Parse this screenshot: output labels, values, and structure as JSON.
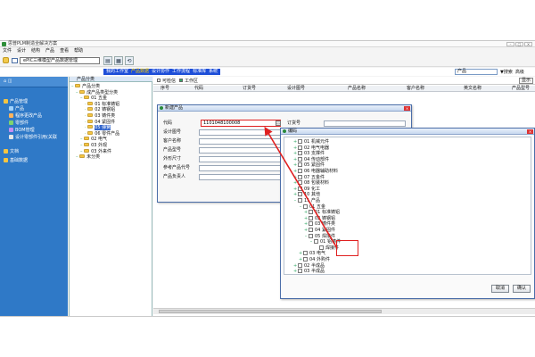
{
  "window": {
    "title": "思普PLM制造全解决方案",
    "controls": [
      "–",
      "□",
      "×"
    ]
  },
  "menu": [
    "文件",
    "设计",
    "结构",
    "产品",
    "查看",
    "帮助"
  ],
  "toolbar": {
    "combo_value": "ePIC三维模型产品数据管理",
    "buttons": [
      "▤",
      "▦",
      "⟲"
    ]
  },
  "worklinks": {
    "items": [
      "我的工作室",
      "产品数据",
      "设计协作",
      "工作流程",
      "标准库",
      "系统"
    ],
    "current_index": 1
  },
  "search": {
    "select_value": "产品",
    "button": "▼搜索",
    "advanced": "高级"
  },
  "leftnav": {
    "header": "⌂ ◫",
    "items": [
      "产品管理",
      "产品",
      "程序更改产品",
      "零部件",
      "BOM管理",
      "设计零部件引用(关联",
      "文档",
      "基础数据"
    ]
  },
  "tree": {
    "header": "产品分类",
    "nodes": [
      {
        "label": "产品分类",
        "level": 0
      },
      {
        "label": "成产品类型分类",
        "level": 1
      },
      {
        "label": "01 五金",
        "level": 2
      },
      {
        "label": "01 标准铸铝",
        "level": 3
      },
      {
        "label": "02 铸钢铝",
        "level": 3
      },
      {
        "label": "03 铸件类",
        "level": 3
      },
      {
        "label": "04 紧固件",
        "level": 3
      },
      {
        "label": "05 弹簧",
        "level": 3
      },
      {
        "label": "06 零件产品",
        "level": 3
      },
      {
        "label": "02 电气",
        "level": 2
      },
      {
        "label": "03 外观",
        "level": 2
      },
      {
        "label": "03 外来件",
        "level": 2
      },
      {
        "label": "未分类",
        "level": 1
      }
    ],
    "selected_index": 7
  },
  "grid": {
    "top_checks": [
      "可检信",
      "工作区"
    ],
    "columns": [
      "序号",
      "代码",
      "订货号",
      "设计图号",
      "产品名称",
      "客户名称",
      "英文名称",
      "产品型号"
    ],
    "right_button": "显示"
  },
  "dialog_new": {
    "title": "新建产品",
    "fields": [
      {
        "label": "代码",
        "value": "1101048100008"
      },
      {
        "label": "设计图号",
        "value": ""
      },
      {
        "label": "客户名称",
        "value": ""
      },
      {
        "label": "产品型号",
        "value": ""
      },
      {
        "label": "外形尺寸",
        "value": ""
      },
      {
        "label": "参考产品代号",
        "value": ""
      },
      {
        "label": "产品负责人",
        "value": ""
      }
    ],
    "order_label": "订货号",
    "code_button": "..."
  },
  "dialog_code": {
    "title": "编码",
    "nodes": [
      {
        "label": "01 机械元件",
        "indent": 1,
        "exp": "+"
      },
      {
        "label": "02 电气电器",
        "indent": 1,
        "exp": "+"
      },
      {
        "label": "03 支撑件",
        "indent": 1,
        "exp": "+"
      },
      {
        "label": "04 传动部件",
        "indent": 1,
        "exp": "+"
      },
      {
        "label": "05 紧固件",
        "indent": 1,
        "exp": "+"
      },
      {
        "label": "06 电器辅助材料",
        "indent": 1,
        "exp": "+"
      },
      {
        "label": "07 五金件",
        "indent": 1,
        "exp": "+"
      },
      {
        "label": "08 包装材料",
        "indent": 1,
        "exp": "+"
      },
      {
        "label": "09 化工",
        "indent": 1,
        "exp": "+"
      },
      {
        "label": "10 其他",
        "indent": 1,
        "exp": "+"
      },
      {
        "label": "11 产品",
        "indent": 1,
        "exp": "–"
      },
      {
        "label": "01 五金",
        "indent": 2,
        "exp": "–"
      },
      {
        "label": "01 标准铸铝",
        "indent": 3,
        "exp": "+"
      },
      {
        "label": "02 铸钢铝",
        "indent": 3,
        "exp": "+"
      },
      {
        "label": "03 铸件类",
        "indent": 3,
        "exp": "+"
      },
      {
        "label": "04 紧固件",
        "indent": 3,
        "exp": "+"
      },
      {
        "label": "05 焊接件",
        "indent": 3,
        "exp": "–"
      },
      {
        "label": "01 铝铸件",
        "indent": 4,
        "exp": "–"
      },
      {
        "label": "焊接件",
        "indent": 5,
        "exp": ""
      },
      {
        "label": "03 电气",
        "indent": 2,
        "exp": "+"
      },
      {
        "label": "04 外购件",
        "indent": 2,
        "exp": "+"
      },
      {
        "label": "02 半成品",
        "indent": 1,
        "exp": "+"
      },
      {
        "label": "03 半成品",
        "indent": 1,
        "exp": "+"
      }
    ],
    "ok_label": "确认",
    "cancel_label": "取消"
  },
  "colors": {
    "nav_bg": "#2f79c7",
    "worklink_bg": "#1d4ed8",
    "highlight": "#e02020",
    "accent": "#ffd200"
  }
}
